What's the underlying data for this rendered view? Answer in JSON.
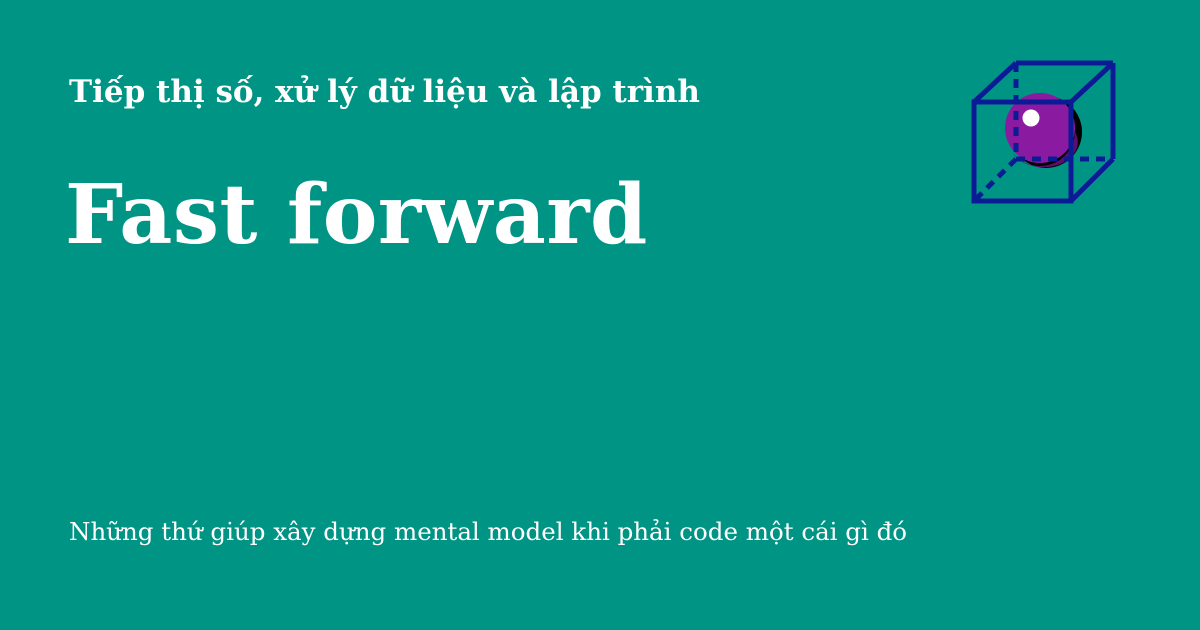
{
  "header": {
    "subtitle": "Tiếp thị số, xử lý dữ liệu và lập trình",
    "title": "Fast forward"
  },
  "footer": {
    "description": "Những thứ giúp xây dựng mental model khi phải code một cái gì đó"
  },
  "logo": {
    "icon": "cube-with-sphere-icon",
    "colors": {
      "cube": "#0b1b96",
      "sphere": "#8a1aa0",
      "sphere_shadow": "#000000",
      "highlight": "#ffffff"
    }
  },
  "colors": {
    "background": "#009485",
    "text": "#ffffff"
  }
}
